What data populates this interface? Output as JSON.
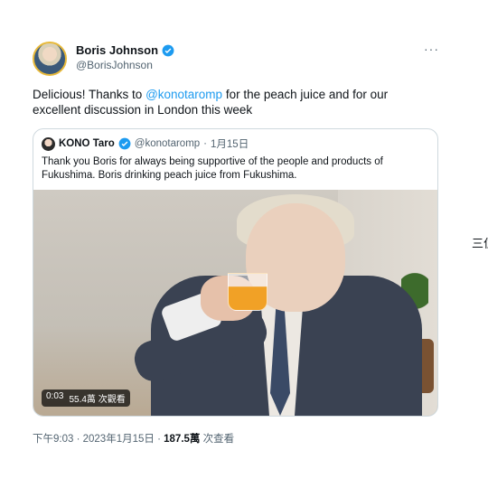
{
  "tweet": {
    "display_name": "Boris Johnson",
    "handle": "@BorisJohnson",
    "more_label": "···",
    "text_before": "Delicious! Thanks to ",
    "mention": "@konotaromp",
    "text_after": " for the peach juice and for our excellent discussion in London this week",
    "time": "下午9:03",
    "sep1": " · ",
    "date": "2023年1月15日",
    "sep2": " · ",
    "views": "187.5萬",
    "views_label": " 次查看"
  },
  "quote": {
    "display_name": "KONO Taro",
    "handle": "@konotaromp",
    "sep": " · ",
    "date": "1月15日",
    "text": "Thank you Boris for always being supportive of the people and products of Fukushima. Boris drinking peach juice from Fukushima.",
    "video_time": "0:03",
    "video_views": "55.4萬 次觀看"
  },
  "side_text": "三位",
  "colors": {
    "verified": "#1d9bf0",
    "mention": "#1d9bf0"
  }
}
